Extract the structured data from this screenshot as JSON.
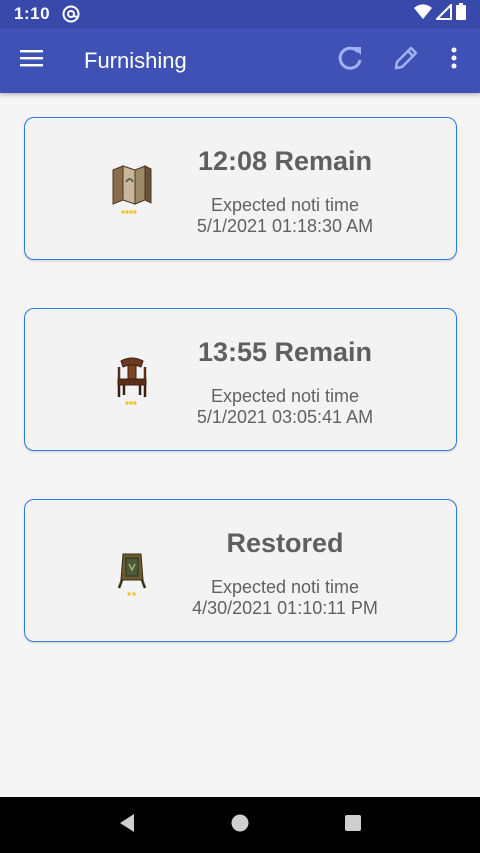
{
  "status_bar": {
    "time": "1:10",
    "icons": [
      "at-sign-icon",
      "wifi-icon",
      "signal-icon",
      "battery-icon"
    ]
  },
  "app_bar": {
    "title": "Furnishing",
    "color": "#3f51b5",
    "actions": [
      "refresh-icon",
      "edit-icon",
      "more-vert-icon"
    ]
  },
  "cards": [
    {
      "status": "12:08 Remain",
      "label": "Expected noti time",
      "time": "5/1/2021 01:18:30 AM",
      "image": "folding-screen-furniture",
      "stars": 4
    },
    {
      "status": "13:55 Remain",
      "label": "Expected noti time",
      "time": "5/1/2021 03:05:41 AM",
      "image": "wooden-chair-furniture",
      "stars": 3
    },
    {
      "status": "Restored",
      "label": "Expected noti time",
      "time": "4/30/2021 01:10:11 PM",
      "image": "standing-board-furniture",
      "stars": 2
    }
  ],
  "nav_bar": {
    "buttons": [
      "back-icon",
      "home-icon",
      "recents-icon"
    ]
  }
}
